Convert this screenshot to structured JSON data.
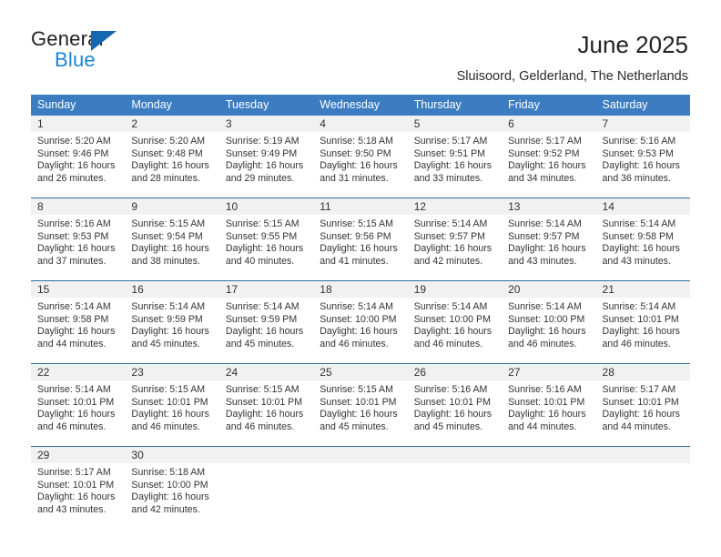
{
  "brand": {
    "name_top": "General",
    "name_bottom": "Blue",
    "triangle_color": "#1667b1",
    "blue_color": "#1a84d6"
  },
  "header": {
    "title": "June 2025",
    "subtitle": "Sluisoord, Gelderland, The Netherlands"
  },
  "colors": {
    "header_row_bg": "#3b7dc0",
    "daynum_band_bg": "#f1f1f1",
    "row_divider": "#2f6cab",
    "text": "#333333"
  },
  "weekday_headers": [
    "Sunday",
    "Monday",
    "Tuesday",
    "Wednesday",
    "Thursday",
    "Friday",
    "Saturday"
  ],
  "labels": {
    "sunrise_prefix": "Sunrise:",
    "sunset_prefix": "Sunset:",
    "daylight_prefix": "Daylight:"
  },
  "weeks": [
    [
      {
        "day": "1",
        "sunrise": "Sunrise: 5:20 AM",
        "sunset": "Sunset: 9:46 PM",
        "daylight_line1": "Daylight: 16 hours",
        "daylight_line2": "and 26 minutes."
      },
      {
        "day": "2",
        "sunrise": "Sunrise: 5:20 AM",
        "sunset": "Sunset: 9:48 PM",
        "daylight_line1": "Daylight: 16 hours",
        "daylight_line2": "and 28 minutes."
      },
      {
        "day": "3",
        "sunrise": "Sunrise: 5:19 AM",
        "sunset": "Sunset: 9:49 PM",
        "daylight_line1": "Daylight: 16 hours",
        "daylight_line2": "and 29 minutes."
      },
      {
        "day": "4",
        "sunrise": "Sunrise: 5:18 AM",
        "sunset": "Sunset: 9:50 PM",
        "daylight_line1": "Daylight: 16 hours",
        "daylight_line2": "and 31 minutes."
      },
      {
        "day": "5",
        "sunrise": "Sunrise: 5:17 AM",
        "sunset": "Sunset: 9:51 PM",
        "daylight_line1": "Daylight: 16 hours",
        "daylight_line2": "and 33 minutes."
      },
      {
        "day": "6",
        "sunrise": "Sunrise: 5:17 AM",
        "sunset": "Sunset: 9:52 PM",
        "daylight_line1": "Daylight: 16 hours",
        "daylight_line2": "and 34 minutes."
      },
      {
        "day": "7",
        "sunrise": "Sunrise: 5:16 AM",
        "sunset": "Sunset: 9:53 PM",
        "daylight_line1": "Daylight: 16 hours",
        "daylight_line2": "and 36 minutes."
      }
    ],
    [
      {
        "day": "8",
        "sunrise": "Sunrise: 5:16 AM",
        "sunset": "Sunset: 9:53 PM",
        "daylight_line1": "Daylight: 16 hours",
        "daylight_line2": "and 37 minutes."
      },
      {
        "day": "9",
        "sunrise": "Sunrise: 5:15 AM",
        "sunset": "Sunset: 9:54 PM",
        "daylight_line1": "Daylight: 16 hours",
        "daylight_line2": "and 38 minutes."
      },
      {
        "day": "10",
        "sunrise": "Sunrise: 5:15 AM",
        "sunset": "Sunset: 9:55 PM",
        "daylight_line1": "Daylight: 16 hours",
        "daylight_line2": "and 40 minutes."
      },
      {
        "day": "11",
        "sunrise": "Sunrise: 5:15 AM",
        "sunset": "Sunset: 9:56 PM",
        "daylight_line1": "Daylight: 16 hours",
        "daylight_line2": "and 41 minutes."
      },
      {
        "day": "12",
        "sunrise": "Sunrise: 5:14 AM",
        "sunset": "Sunset: 9:57 PM",
        "daylight_line1": "Daylight: 16 hours",
        "daylight_line2": "and 42 minutes."
      },
      {
        "day": "13",
        "sunrise": "Sunrise: 5:14 AM",
        "sunset": "Sunset: 9:57 PM",
        "daylight_line1": "Daylight: 16 hours",
        "daylight_line2": "and 43 minutes."
      },
      {
        "day": "14",
        "sunrise": "Sunrise: 5:14 AM",
        "sunset": "Sunset: 9:58 PM",
        "daylight_line1": "Daylight: 16 hours",
        "daylight_line2": "and 43 minutes."
      }
    ],
    [
      {
        "day": "15",
        "sunrise": "Sunrise: 5:14 AM",
        "sunset": "Sunset: 9:58 PM",
        "daylight_line1": "Daylight: 16 hours",
        "daylight_line2": "and 44 minutes."
      },
      {
        "day": "16",
        "sunrise": "Sunrise: 5:14 AM",
        "sunset": "Sunset: 9:59 PM",
        "daylight_line1": "Daylight: 16 hours",
        "daylight_line2": "and 45 minutes."
      },
      {
        "day": "17",
        "sunrise": "Sunrise: 5:14 AM",
        "sunset": "Sunset: 9:59 PM",
        "daylight_line1": "Daylight: 16 hours",
        "daylight_line2": "and 45 minutes."
      },
      {
        "day": "18",
        "sunrise": "Sunrise: 5:14 AM",
        "sunset": "Sunset: 10:00 PM",
        "daylight_line1": "Daylight: 16 hours",
        "daylight_line2": "and 46 minutes."
      },
      {
        "day": "19",
        "sunrise": "Sunrise: 5:14 AM",
        "sunset": "Sunset: 10:00 PM",
        "daylight_line1": "Daylight: 16 hours",
        "daylight_line2": "and 46 minutes."
      },
      {
        "day": "20",
        "sunrise": "Sunrise: 5:14 AM",
        "sunset": "Sunset: 10:00 PM",
        "daylight_line1": "Daylight: 16 hours",
        "daylight_line2": "and 46 minutes."
      },
      {
        "day": "21",
        "sunrise": "Sunrise: 5:14 AM",
        "sunset": "Sunset: 10:01 PM",
        "daylight_line1": "Daylight: 16 hours",
        "daylight_line2": "and 46 minutes."
      }
    ],
    [
      {
        "day": "22",
        "sunrise": "Sunrise: 5:14 AM",
        "sunset": "Sunset: 10:01 PM",
        "daylight_line1": "Daylight: 16 hours",
        "daylight_line2": "and 46 minutes."
      },
      {
        "day": "23",
        "sunrise": "Sunrise: 5:15 AM",
        "sunset": "Sunset: 10:01 PM",
        "daylight_line1": "Daylight: 16 hours",
        "daylight_line2": "and 46 minutes."
      },
      {
        "day": "24",
        "sunrise": "Sunrise: 5:15 AM",
        "sunset": "Sunset: 10:01 PM",
        "daylight_line1": "Daylight: 16 hours",
        "daylight_line2": "and 46 minutes."
      },
      {
        "day": "25",
        "sunrise": "Sunrise: 5:15 AM",
        "sunset": "Sunset: 10:01 PM",
        "daylight_line1": "Daylight: 16 hours",
        "daylight_line2": "and 45 minutes."
      },
      {
        "day": "26",
        "sunrise": "Sunrise: 5:16 AM",
        "sunset": "Sunset: 10:01 PM",
        "daylight_line1": "Daylight: 16 hours",
        "daylight_line2": "and 45 minutes."
      },
      {
        "day": "27",
        "sunrise": "Sunrise: 5:16 AM",
        "sunset": "Sunset: 10:01 PM",
        "daylight_line1": "Daylight: 16 hours",
        "daylight_line2": "and 44 minutes."
      },
      {
        "day": "28",
        "sunrise": "Sunrise: 5:17 AM",
        "sunset": "Sunset: 10:01 PM",
        "daylight_line1": "Daylight: 16 hours",
        "daylight_line2": "and 44 minutes."
      }
    ],
    [
      {
        "day": "29",
        "sunrise": "Sunrise: 5:17 AM",
        "sunset": "Sunset: 10:01 PM",
        "daylight_line1": "Daylight: 16 hours",
        "daylight_line2": "and 43 minutes."
      },
      {
        "day": "30",
        "sunrise": "Sunrise: 5:18 AM",
        "sunset": "Sunset: 10:00 PM",
        "daylight_line1": "Daylight: 16 hours",
        "daylight_line2": "and 42 minutes."
      },
      {
        "day": "",
        "sunrise": "",
        "sunset": "",
        "daylight_line1": "",
        "daylight_line2": ""
      },
      {
        "day": "",
        "sunrise": "",
        "sunset": "",
        "daylight_line1": "",
        "daylight_line2": ""
      },
      {
        "day": "",
        "sunrise": "",
        "sunset": "",
        "daylight_line1": "",
        "daylight_line2": ""
      },
      {
        "day": "",
        "sunrise": "",
        "sunset": "",
        "daylight_line1": "",
        "daylight_line2": ""
      },
      {
        "day": "",
        "sunrise": "",
        "sunset": "",
        "daylight_line1": "",
        "daylight_line2": ""
      }
    ]
  ]
}
